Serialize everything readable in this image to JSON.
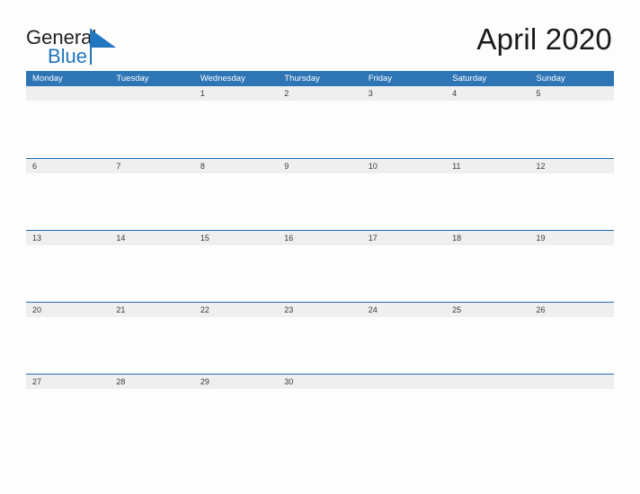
{
  "brand": {
    "name_line1": "General",
    "name_line2": "Blue",
    "flag_icon": "blue-triangle-flag-icon",
    "color_dark": "#231F20",
    "color_blue": "#2077C0"
  },
  "header": {
    "title": "April 2020",
    "month": "April",
    "year": "2020"
  },
  "theme": {
    "header_blue": "#2E75B6",
    "rule_blue": "#1F6BAF",
    "date_band_gray": "#EFEFEF",
    "page_background": "#FDFDFD",
    "date_text": "#3A3A3A",
    "weekday_text": "#FFFFFF"
  },
  "calendar": {
    "weekdays": [
      "Monday",
      "Tuesday",
      "Wednesday",
      "Thursday",
      "Friday",
      "Saturday",
      "Sunday"
    ],
    "weeks": [
      [
        "",
        "",
        "1",
        "2",
        "3",
        "4",
        "5"
      ],
      [
        "6",
        "7",
        "8",
        "9",
        "10",
        "11",
        "12"
      ],
      [
        "13",
        "14",
        "15",
        "16",
        "17",
        "18",
        "19"
      ],
      [
        "20",
        "21",
        "22",
        "23",
        "24",
        "25",
        "26"
      ],
      [
        "27",
        "28",
        "29",
        "30",
        "",
        "",
        ""
      ]
    ]
  }
}
